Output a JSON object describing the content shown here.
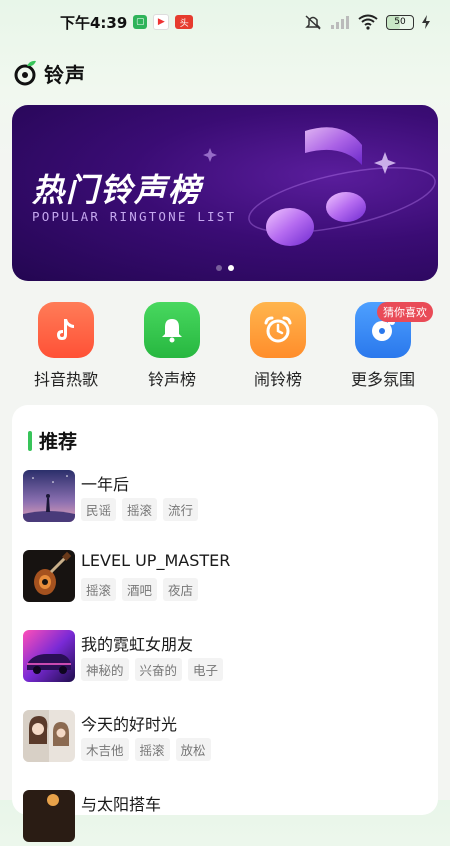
{
  "status_bar": {
    "time": "下午4:39",
    "battery": "50"
  },
  "app": {
    "title": "铃声"
  },
  "banner": {
    "title": "热门铃声榜",
    "subtitle": "POPULAR RINGTONE LIST",
    "page_count": 2,
    "active_page": 2
  },
  "quick_nav": [
    {
      "label": "抖音热歌",
      "icon": "tiktok-icon",
      "color": "#ff6a47"
    },
    {
      "label": "铃声榜",
      "icon": "bell-icon",
      "color": "#35c94f"
    },
    {
      "label": "闹铃榜",
      "icon": "alarm-clock-icon",
      "color": "#ffa63a"
    },
    {
      "label": "更多氛围",
      "icon": "music-disc-icon",
      "color": "#3c8ef5",
      "badge": "猜你喜欢"
    }
  ],
  "recommend": {
    "title": "推荐",
    "items": [
      {
        "title": "一年后",
        "tags": [
          "民谣",
          "摇滚",
          "流行"
        ]
      },
      {
        "title": "LEVEL UP_MASTER",
        "tags": [
          "摇滚",
          "酒吧",
          "夜店"
        ]
      },
      {
        "title": "我的霓虹女朋友",
        "tags": [
          "神秘的",
          "兴奋的",
          "电子"
        ]
      },
      {
        "title": "今天的好时光",
        "tags": [
          "木吉他",
          "摇滚",
          "放松"
        ]
      },
      {
        "title": "与太阳搭车",
        "tags": []
      }
    ]
  },
  "colors": {
    "accent": "#38c45a",
    "badge": "#e94b57",
    "banner_bg": "#3a0c74"
  }
}
